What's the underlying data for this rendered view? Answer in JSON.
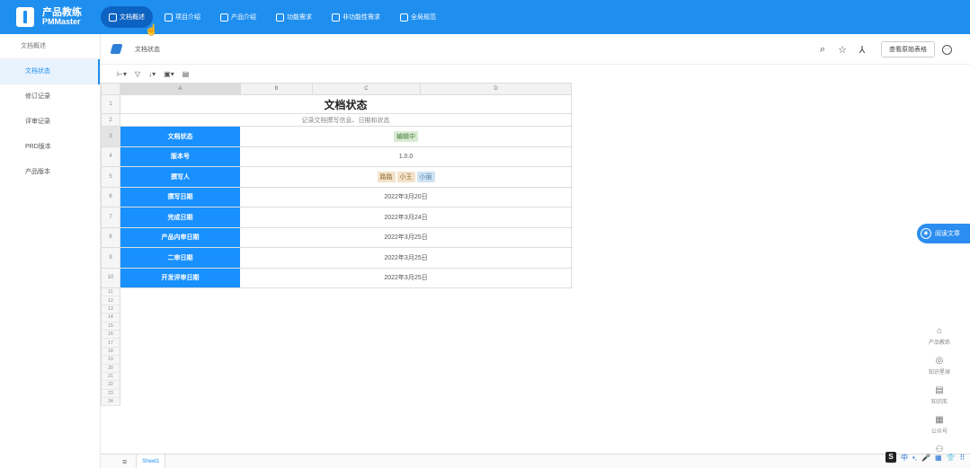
{
  "brand": {
    "name_cn": "产品教练",
    "name_en": "PMMaster"
  },
  "nav": [
    {
      "label": "文档概述",
      "icon": "list-icon",
      "active": true
    },
    {
      "label": "项目介绍",
      "icon": "doc-icon",
      "active": false
    },
    {
      "label": "产品介绍",
      "icon": "user-icon",
      "active": false
    },
    {
      "label": "功能需求",
      "icon": "calendar-icon",
      "active": false
    },
    {
      "label": "非功能性需求",
      "icon": "table-icon",
      "active": false
    },
    {
      "label": "全局规范",
      "icon": "folder-icon",
      "active": false
    }
  ],
  "sidebar": {
    "title": "文档概述",
    "items": [
      {
        "label": "文档状态",
        "active": true
      },
      {
        "label": "修订记录",
        "active": false
      },
      {
        "label": "评审记录",
        "active": false
      },
      {
        "label": "PRD版本",
        "active": false
      },
      {
        "label": "产品版本",
        "active": false
      }
    ]
  },
  "doc": {
    "title": "文档状态",
    "raw_button": "查看原始表格"
  },
  "sheet": {
    "columns": [
      "A",
      "B",
      "C",
      "D"
    ],
    "title": "文档状态",
    "subtitle": "记录文档撰写信息、日期和状态",
    "rows": [
      {
        "n": "3",
        "label": "文档状态",
        "value": "",
        "tags": [
          {
            "text": "编辑中",
            "color": "green"
          }
        ]
      },
      {
        "n": "4",
        "label": "版本号",
        "value": "1.0.0",
        "tags": []
      },
      {
        "n": "5",
        "label": "撰写人",
        "value": "",
        "tags": [
          {
            "text": "路路",
            "color": "orange"
          },
          {
            "text": "小王",
            "color": "orange"
          },
          {
            "text": "小丽",
            "color": "blue"
          }
        ]
      },
      {
        "n": "6",
        "label": "撰写日期",
        "value": "2022年3月20日",
        "tags": []
      },
      {
        "n": "7",
        "label": "完成日期",
        "value": "2022年3月24日",
        "tags": []
      },
      {
        "n": "8",
        "label": "产品内审日期",
        "value": "2022年3月25日",
        "tags": []
      },
      {
        "n": "9",
        "label": "二审日期",
        "value": "2022年3月25日",
        "tags": []
      },
      {
        "n": "10",
        "label": "开发评审日期",
        "value": "2022年3月25日",
        "tags": []
      }
    ],
    "row_numbers_top": [
      "1",
      "2"
    ],
    "empty_rows": [
      "11",
      "12",
      "13",
      "14",
      "15",
      "16",
      "17",
      "18",
      "19",
      "20",
      "21",
      "22",
      "23",
      "24"
    ],
    "tab": "Sheet1"
  },
  "float": {
    "read_label": "阅读文章",
    "tools": [
      {
        "label": "产品教练",
        "icon": "home-icon",
        "glyph": "⌂"
      },
      {
        "label": "知识星球",
        "icon": "globe-icon",
        "glyph": "◎"
      },
      {
        "label": "知识库",
        "icon": "book-icon",
        "glyph": "▤"
      },
      {
        "label": "公众号",
        "icon": "grid-icon",
        "glyph": "▦"
      },
      {
        "label": "",
        "icon": "users-icon",
        "glyph": "⚇"
      }
    ]
  },
  "ime": {
    "s": "S",
    "items": [
      "中",
      "•,",
      "🎤",
      "▦",
      "👕",
      "⠿"
    ]
  },
  "colors": {
    "primary": "#1f8fef",
    "label_bg": "#1890ff"
  }
}
